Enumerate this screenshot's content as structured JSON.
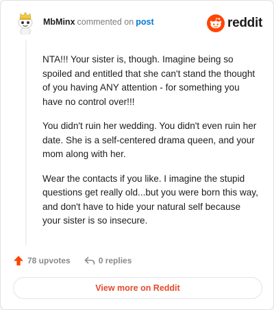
{
  "comment": {
    "username": "MbMinx",
    "action": "commented on",
    "post_link": "post",
    "paragraphs": [
      "NTA!!! Your sister is, though. Imagine being so spoiled and entitled that she can't stand the thought of you having ANY attention - for something you have no control over!!!",
      "You didn't ruin her wedding. You didn't even ruin her date. She is a self-centered drama queen, and your mom along with her.",
      "Wear the contacts if you like. I imagine the stupid questions get really old...but you were born this way, and don't have to hide your natural self because your sister is so insecure."
    ]
  },
  "brand": {
    "name": "reddit",
    "icon": "reddit-logo-icon",
    "color": "#ff4500"
  },
  "actions": {
    "upvotes": "78 upvotes",
    "replies": "0 replies",
    "upvote_icon": "upvote-arrow-icon",
    "reply_icon": "reply-arrow-icon",
    "upvote_color": "#ff4500"
  },
  "footer": {
    "view_more": "View more on Reddit",
    "accent": "#e4492b"
  }
}
